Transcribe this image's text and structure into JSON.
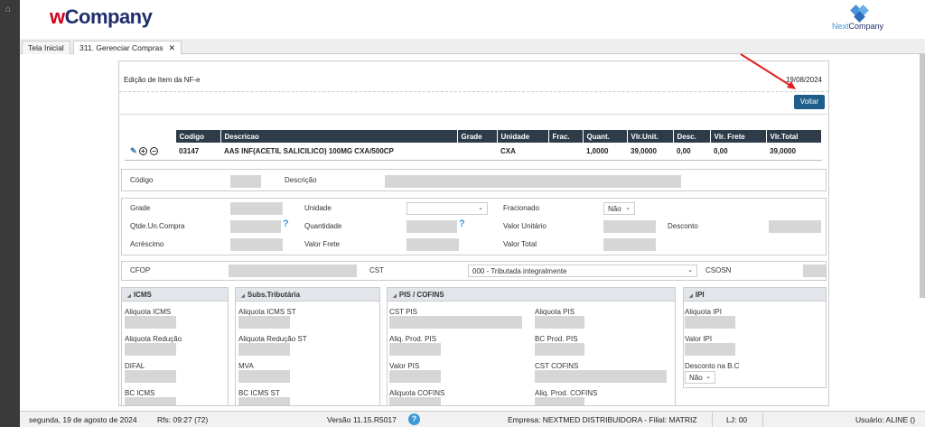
{
  "header": {
    "logo_w": "w",
    "logo_company": "Company",
    "brand_next": "Next",
    "brand_company": "Company"
  },
  "tabs": [
    {
      "label": "Tela Inicial"
    },
    {
      "label": "311. Gerenciar Compras"
    }
  ],
  "page": {
    "title": "Edição de Item da NF-e",
    "date": "19/08/2024",
    "voltar_label": "Voltar"
  },
  "item_table": {
    "headers": [
      "Codigo",
      "Descricao",
      "Grade",
      "Unidade",
      "Frac.",
      "Quant.",
      "Vlr.Unit.",
      "Desc.",
      "Vlr. Frete",
      "Vlr.Total"
    ],
    "row": [
      "03147",
      "AAS INF(ACETIL SALICILICO) 100MG CXA/500CP",
      "",
      "CXA",
      "",
      "1,0000",
      "39,0000",
      "0,00",
      "0,00",
      "39,0000"
    ]
  },
  "fields": {
    "codigo": "Código",
    "descricao": "Descrição",
    "grade": "Grade",
    "unidade": "Unidade",
    "fracionado": "Fracionado",
    "fracionado_value": "Não",
    "qtde_un_compra": "Qtde.Un.Compra",
    "quantidade": "Quantidade",
    "valor_unitario": "Valor Unitário",
    "desconto": "Desconto",
    "acrescimo": "Acréscimo",
    "valor_frete": "Valor Frete",
    "valor_total": "Valor Total",
    "cfop": "CFOP",
    "cst": "CST",
    "cst_value": "000 - Tributada integralmente",
    "csosn": "CSOSN"
  },
  "panels": {
    "icms": {
      "title": "ICMS",
      "aliquota": "Aliquota ICMS",
      "aliquota_reducao": "Aliquota Redução",
      "difal": "DIFAL",
      "bc_icms": "BC ICMS"
    },
    "subs": {
      "title": "Subs.Tributária",
      "aliquota_st": "Aliquota ICMS ST",
      "aliquota_reducao_st": "Aliquota Redução ST",
      "mva": "MVA",
      "bc_icms_st": "BC ICMS ST"
    },
    "pis": {
      "title": "PIS / COFINS",
      "cst_pis": "CST PIS",
      "aliquota_pis": "Aliquota PIS",
      "aliq_prod_pis": "Aliq. Prod. PIS",
      "bc_prod_pis": "BC Prod. PIS",
      "valor_pis": "Valor PIS",
      "cst_cofins": "CST COFINS",
      "aliquota_cofins": "Aliquota COFINS",
      "aliq_prod_cofins": "Aliq. Prod. COFINS"
    },
    "ipi": {
      "title": "IPI",
      "aliquota_ipi": "Aliquota IPI",
      "valor_ipi": "Valor IPI",
      "desconto_bc": "Desconto na B.C",
      "desconto_bc_value": "Não"
    }
  },
  "status": {
    "date": "segunda, 19 de agosto de 2024",
    "rfs": "Rfs: 09:27 (72)",
    "version": "Versão 11.15.R5017",
    "empresa": "Empresa: NEXTMED DISTRIBUIDORA - Filial: MATRIZ",
    "lj": "LJ: 00",
    "usuario": "Usuário: ALINE ()"
  },
  "colors": {
    "header_dark": "#2e3c4a",
    "button": "#1f5d8a",
    "accent": "#3a9ad9",
    "brand_red": "#d0021b",
    "brand_navy": "#1f2d6b",
    "arrow": "#e02020"
  }
}
